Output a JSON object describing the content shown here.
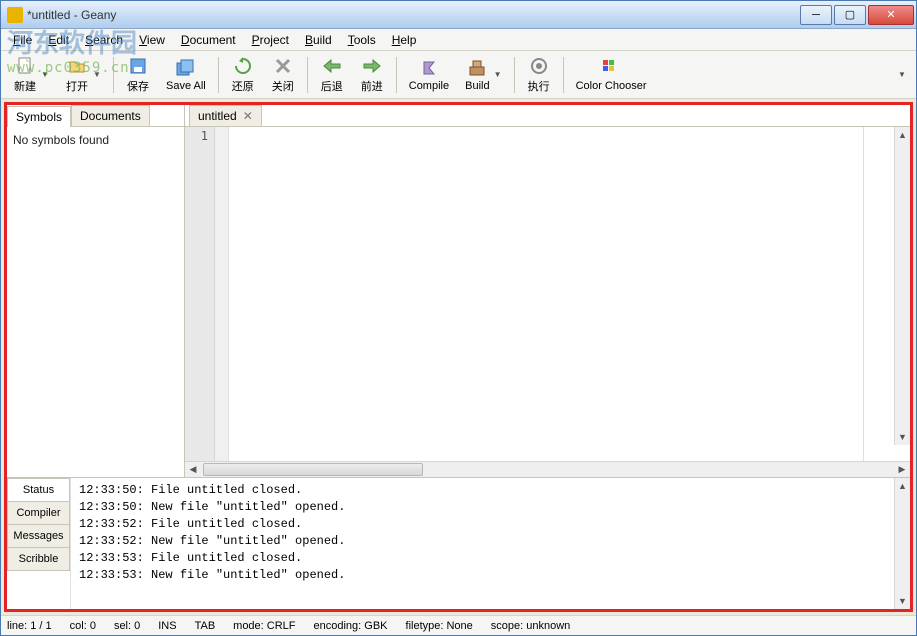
{
  "window": {
    "title": "*untitled - Geany"
  },
  "menu": {
    "file": "File",
    "edit": "Edit",
    "search": "Search",
    "view": "View",
    "document": "Document",
    "project": "Project",
    "build": "Build",
    "tools": "Tools",
    "help": "Help"
  },
  "toolbar": {
    "new": "新建",
    "open": "打开",
    "save": "保存",
    "save_all": "Save All",
    "revert": "还原",
    "close": "关闭",
    "back": "后退",
    "forward": "前进",
    "compile": "Compile",
    "build": "Build",
    "execute": "执行",
    "color_chooser": "Color Chooser"
  },
  "sidebar": {
    "tabs": {
      "symbols": "Symbols",
      "documents": "Documents"
    },
    "body": "No symbols found"
  },
  "editor": {
    "tab": "untitled",
    "line1": "1"
  },
  "bottom": {
    "tabs": {
      "status": "Status",
      "compiler": "Compiler",
      "messages": "Messages",
      "scribble": "Scribble"
    },
    "lines": [
      "12:33:50: File untitled closed.",
      "12:33:50: New file \"untitled\" opened.",
      "12:33:52: File untitled closed.",
      "12:33:52: New file \"untitled\" opened.",
      "12:33:53: File untitled closed.",
      "12:33:53: New file \"untitled\" opened."
    ]
  },
  "status": {
    "line": "line: 1 / 1",
    "col": "col: 0",
    "sel": "sel: 0",
    "ins": "INS",
    "tab": "TAB",
    "mode": "mode: CRLF",
    "encoding": "encoding: GBK",
    "filetype": "filetype: None",
    "scope": "scope: unknown"
  },
  "watermark": {
    "line1": "河东软件园",
    "line2": "www.pc0359.cn"
  }
}
